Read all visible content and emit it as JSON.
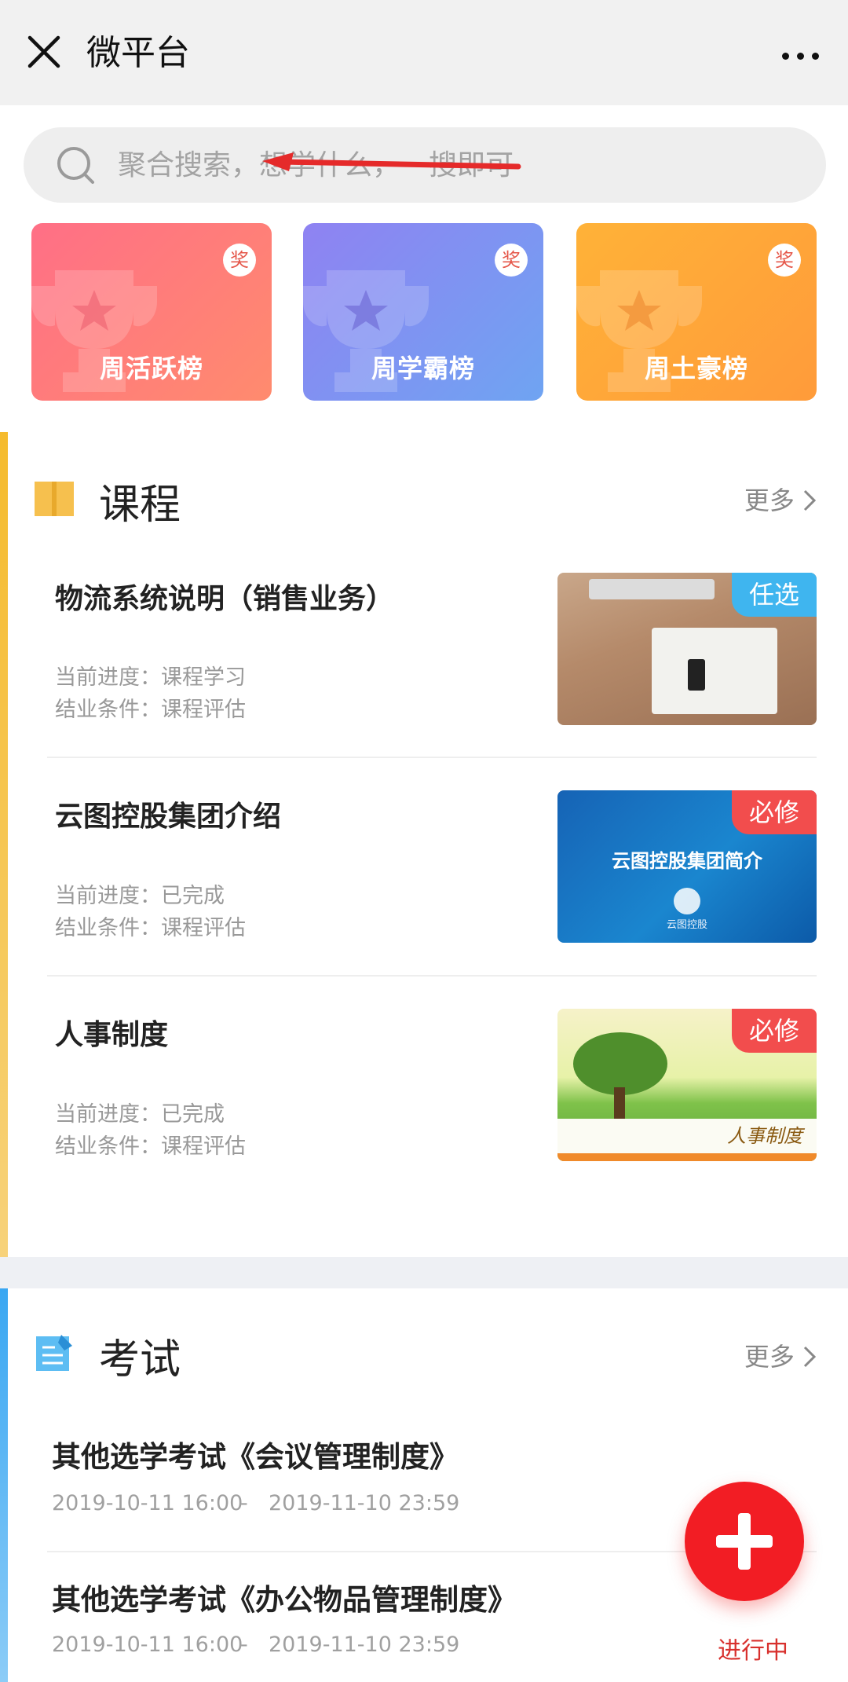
{
  "topbar": {
    "title": "微平台",
    "close_icon": "close-icon",
    "more_icon": "more-dots-icon"
  },
  "search": {
    "placeholder": "聚合搜索，想学什么，一搜即可",
    "icon": "search-icon"
  },
  "awards": [
    {
      "label": "周活跃榜",
      "badge": "奖",
      "color": "#ff7383"
    },
    {
      "label": "周学霸榜",
      "badge": "奖",
      "color": "#7f93f2"
    },
    {
      "label": "周土豪榜",
      "badge": "奖",
      "color": "#ffa63a"
    }
  ],
  "courses": {
    "title": "课程",
    "more": "更多",
    "accent": "#f5bf3d",
    "items": [
      {
        "title": "物流系统说明（销售业务）",
        "progress": "当前进度：课程学习",
        "condition": "结业条件：课程评估",
        "tag": "任选"
      },
      {
        "title": "云图控股集团介绍",
        "progress": "当前进度：已完成",
        "condition": "结业条件：课程评估",
        "tag": "必修",
        "thumb_text": "云图控股集团简介",
        "thumb_logo": "云图控股"
      },
      {
        "title": "人事制度",
        "progress": "当前进度：已完成",
        "condition": "结业条件：课程评估",
        "tag": "必修",
        "thumb_text": "人事制度"
      }
    ]
  },
  "exams": {
    "title": "考试",
    "more": "更多",
    "accent": "#46aef3",
    "items": [
      {
        "title": "其他选学考试《会议管理制度》",
        "start": "2019-10-11 16:00",
        "dash": "-",
        "end": "2019-11-10 23:59"
      },
      {
        "title": "其他选学考试《办公物品管理制度》",
        "start": "2019-10-11 16:00",
        "dash": "-",
        "end": "2019-11-10 23:59"
      }
    ]
  },
  "fab": {
    "icon": "plus-icon",
    "label": "进行中",
    "color": "#f21d24"
  }
}
